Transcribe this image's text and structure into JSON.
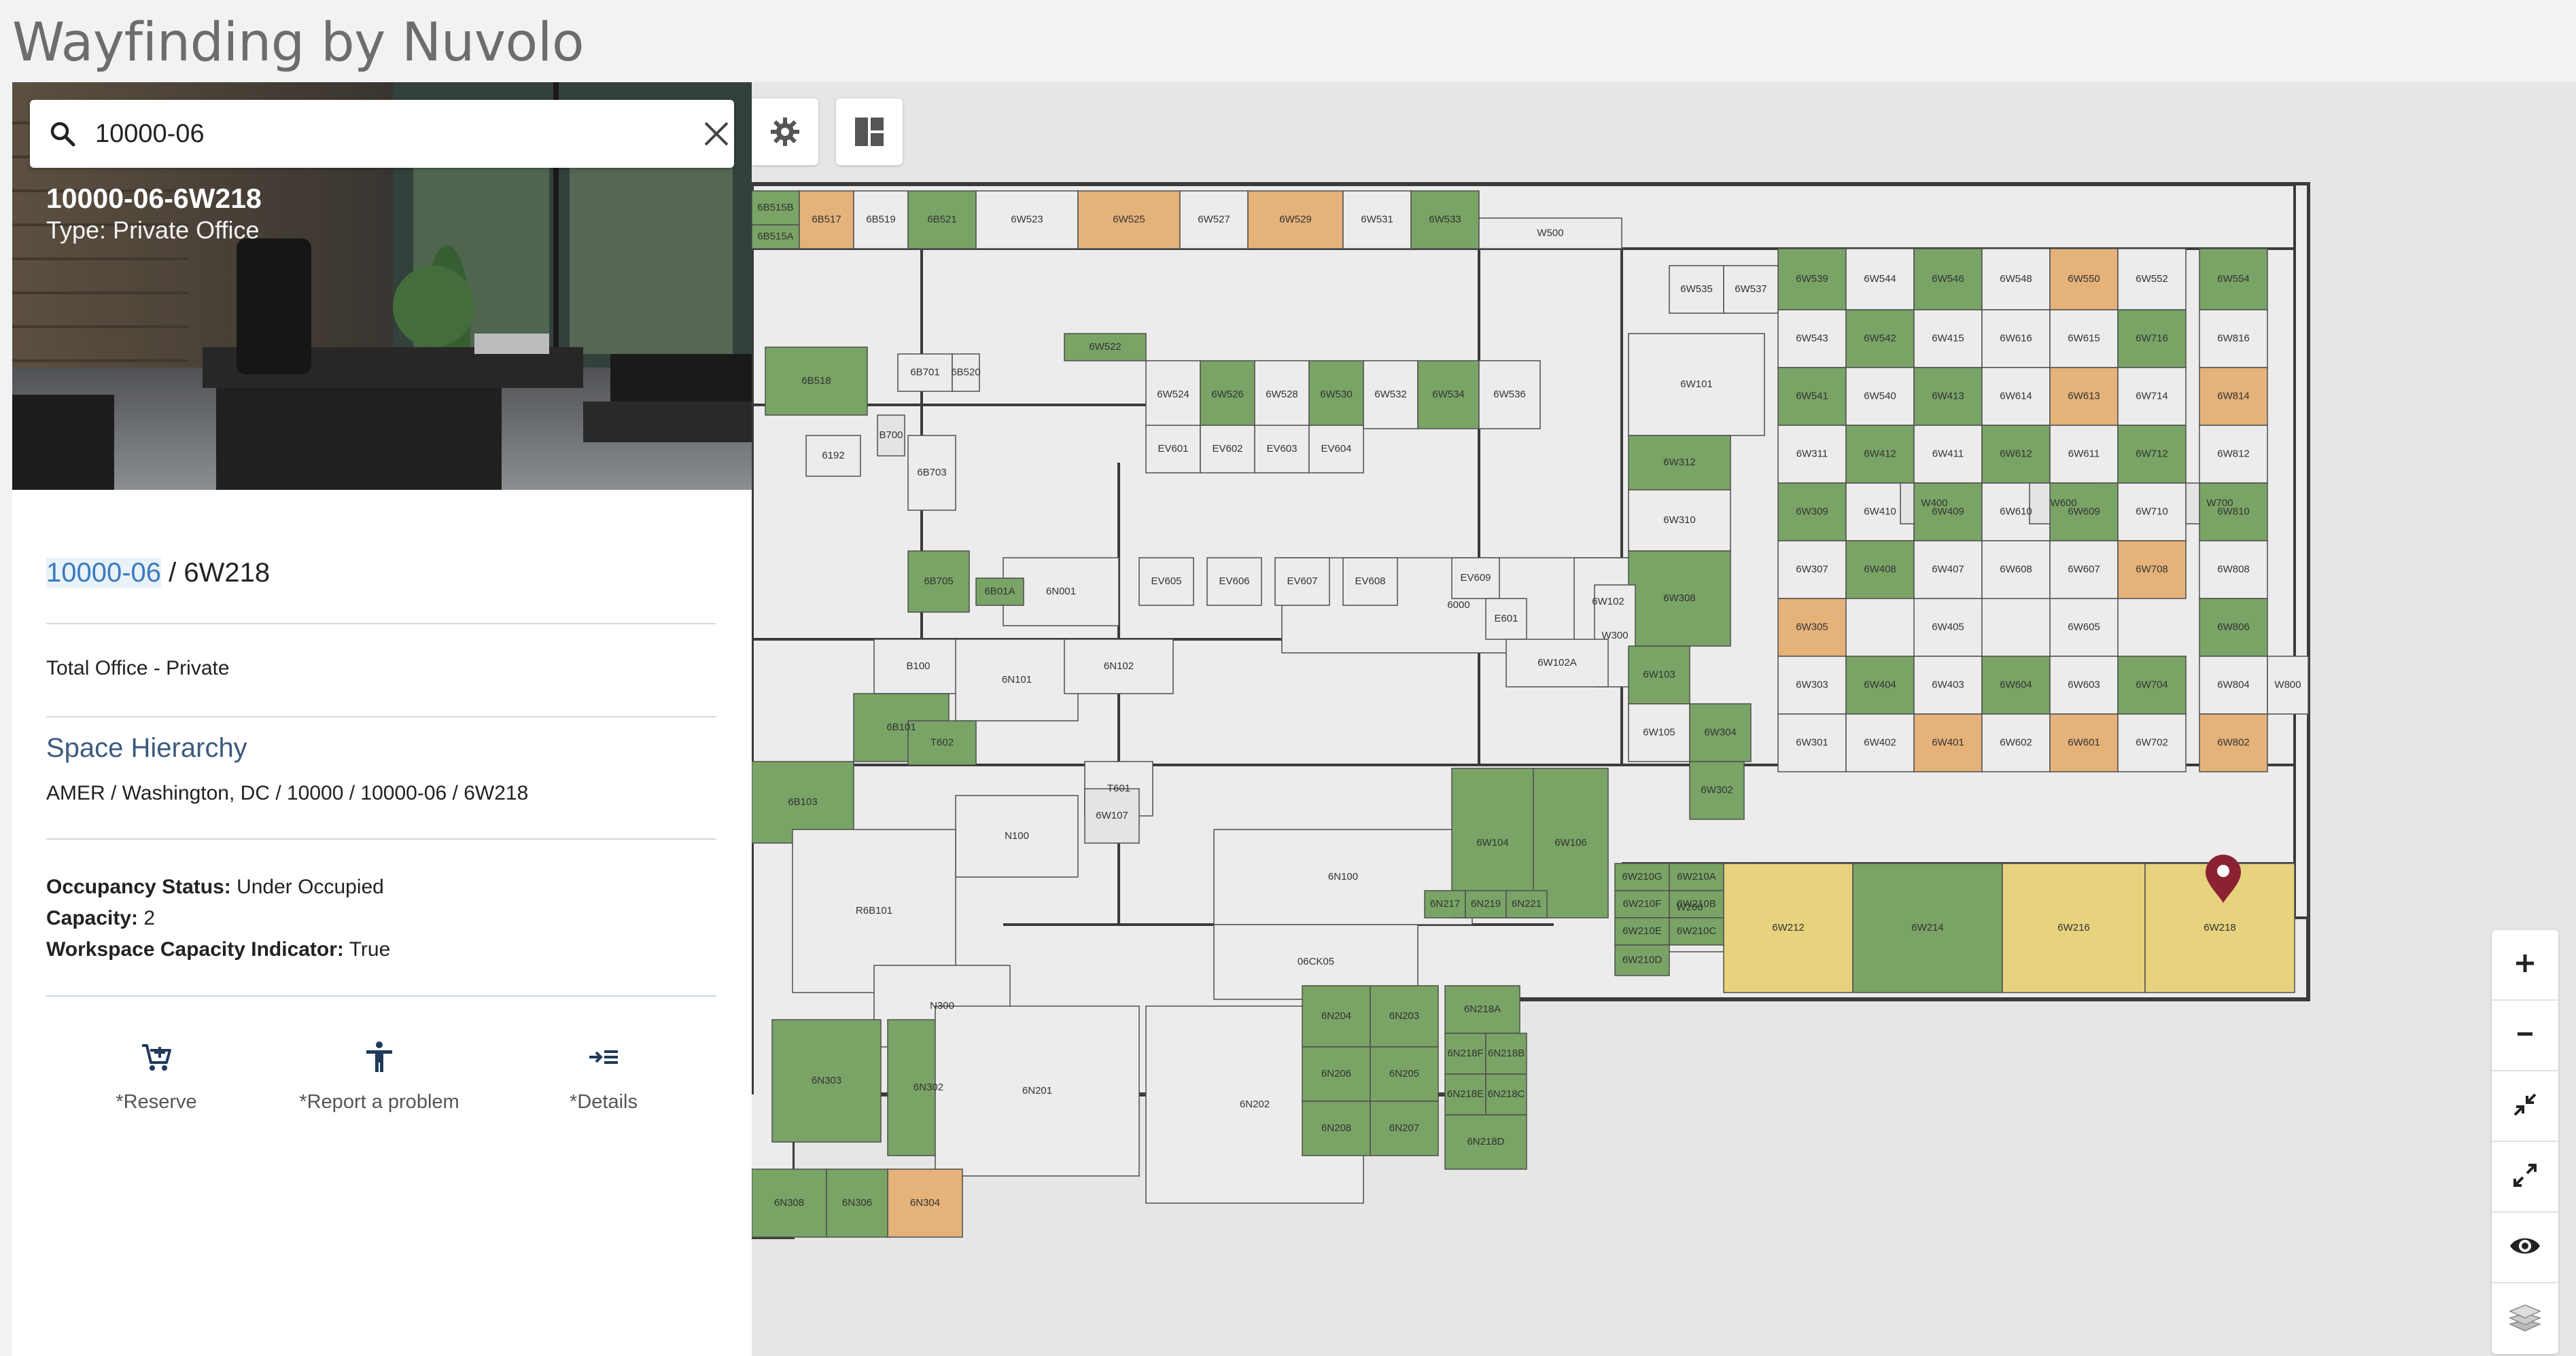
{
  "app": {
    "title": "Wayfinding by Nuvolo"
  },
  "search": {
    "value": "10000-06",
    "placeholder": ""
  },
  "space": {
    "header_title": "10000-06-6W218",
    "header_type": "Type: Private Office",
    "breadcrumb_link": "10000-06",
    "breadcrumb_sep": " / ",
    "breadcrumb_current": "6W218",
    "space_type": "Total Office - Private",
    "hierarchy_title": "Space Hierarchy",
    "hierarchy_path": "AMER / Washington, DC / 10000 / 10000-06 / 6W218",
    "properties": [
      {
        "key": "Occupancy Status:",
        "value": " Under Occupied"
      },
      {
        "key": "Capacity:",
        "value": " 2"
      },
      {
        "key": "Workspace Capacity Indicator:",
        "value": " True"
      }
    ]
  },
  "actions": [
    {
      "label": "*Reserve",
      "icon": "add-cart-icon"
    },
    {
      "label": "*Report a problem",
      "icon": "accessibility-person-icon"
    },
    {
      "label": "*Details",
      "icon": "details-list-icon"
    }
  ],
  "map": {
    "toolbar": [
      {
        "icon": "gear-icon"
      },
      {
        "icon": "dashboard-layout-icon"
      }
    ],
    "controls": [
      {
        "icon": "zoom-in-icon"
      },
      {
        "icon": "zoom-out-icon"
      },
      {
        "icon": "collapse-icon"
      },
      {
        "icon": "expand-icon"
      },
      {
        "icon": "eye-icon"
      },
      {
        "icon": "layers-icon"
      }
    ],
    "selected_room": "6W218",
    "colors": {
      "occupied_green": "#79a466",
      "orange": "#e5b27a",
      "highlight_yellow": "#e7d27e",
      "pin": "#8b2232",
      "link_blue": "#3a7bbd"
    },
    "room_labels": [
      "6B515B",
      "6B515A",
      "6B517",
      "6B519",
      "6B521",
      "6W523",
      "6W525",
      "6W527",
      "6W529",
      "6W531",
      "6W533",
      "W500",
      "6W539",
      "6W544",
      "6W546",
      "6W548",
      "6W550",
      "6W552",
      "6W554",
      "6W535",
      "6W537",
      "6W543",
      "6W542",
      "6W415",
      "6W616",
      "6W615",
      "6W716",
      "6W816",
      "6W522",
      "6W524",
      "6W526",
      "6W528",
      "6W530",
      "6W532",
      "6W534",
      "6W536",
      "6W101",
      "6W541",
      "6W540",
      "6W413",
      "6W614",
      "6W613",
      "6W714",
      "6W814",
      "6B518",
      "6B701",
      "6B520",
      "B700",
      "6192",
      "6B703",
      "EV601",
      "EV602",
      "EV603",
      "EV604",
      "6W312",
      "6W311",
      "6W412",
      "6W411",
      "6W612",
      "6W611",
      "6W712",
      "6W812",
      "6N001",
      "6000",
      "6W102",
      "6W310",
      "6W309",
      "6W410",
      "W400",
      "6W409",
      "6W610",
      "W600",
      "6W609",
      "6W710",
      "W700",
      "6W810",
      "6B705",
      "6B01A",
      "EV605",
      "EV606",
      "EV607",
      "EV608",
      "EV609",
      "E601",
      "6W308",
      "W300",
      "6W307",
      "6W408",
      "6W407",
      "6W608",
      "6W607",
      "6W708",
      "6W808",
      "6W103",
      "6W305",
      "6W405",
      "6W605",
      "6W806",
      "B100",
      "6N101",
      "6N102",
      "6W102A",
      "6W105",
      "6W304",
      "6W303",
      "6W404",
      "6W403",
      "6W604",
      "6W603",
      "6W704",
      "6W804",
      "W800",
      "6B103",
      "6B101",
      "T602",
      "T601",
      "6W107",
      "6W302",
      "6W301",
      "6W402",
      "6W401",
      "6W602",
      "6W601",
      "6W702",
      "6W802",
      "N100",
      "R6B101",
      "6N100",
      "6W104",
      "6W106",
      "W200",
      "6W210G",
      "6W210A",
      "6W210F",
      "6W210B",
      "6W210E",
      "6W210C",
      "6W210D",
      "6W212",
      "6W214",
      "6W216",
      "6W218",
      "6N217",
      "6N219",
      "6N221",
      "06CK05",
      "N300",
      "6N303",
      "6N302",
      "6N201",
      "6N202",
      "6N204",
      "6N203",
      "6N206",
      "6N205",
      "6N208",
      "6N207",
      "6N218A",
      "6N218F",
      "6N218B",
      "6N218E",
      "6N218C",
      "6N218D",
      "6N304",
      "6N308",
      "6N306"
    ]
  }
}
